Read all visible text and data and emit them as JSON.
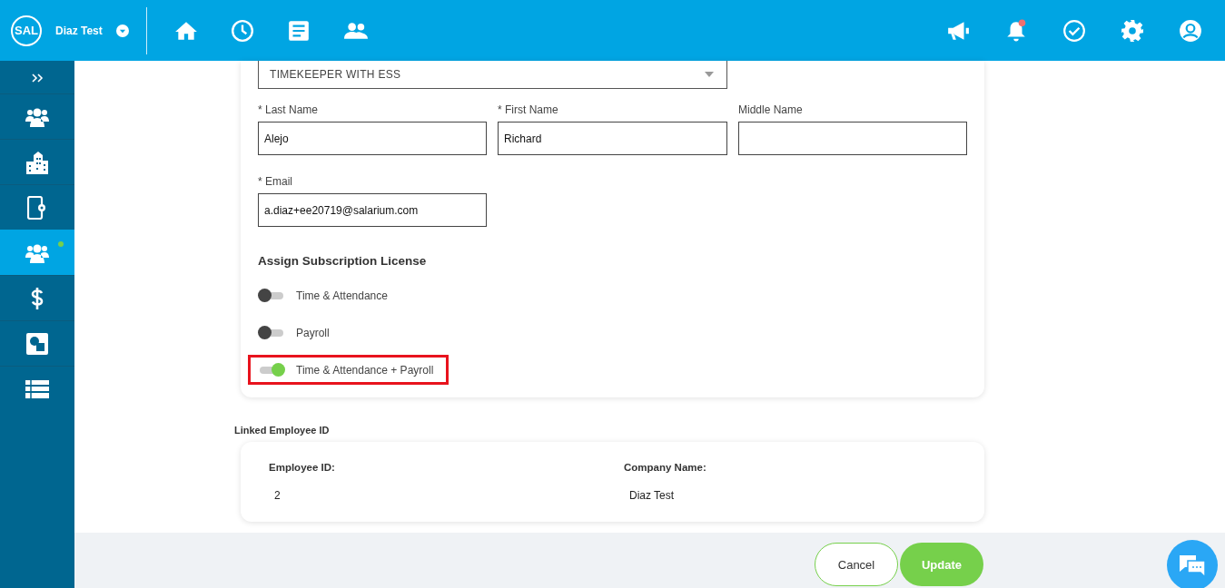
{
  "header": {
    "logo": "SAL",
    "company": "Diaz Test",
    "unread_notifications": true
  },
  "sidebar": {
    "items": [
      {
        "kind": "people",
        "selected": false,
        "badge": false
      },
      {
        "kind": "building",
        "selected": false,
        "badge": false
      },
      {
        "kind": "device",
        "selected": false,
        "badge": false
      },
      {
        "kind": "people",
        "selected": true,
        "badge": true
      },
      {
        "kind": "dollar",
        "selected": false,
        "badge": false
      },
      {
        "kind": "shapes",
        "selected": false,
        "badge": false
      },
      {
        "kind": "list",
        "selected": false,
        "badge": false
      }
    ]
  },
  "form": {
    "role": "TIMEKEEPER WITH ESS",
    "fields": [
      {
        "label": "* Last Name",
        "value": "Alejo"
      },
      {
        "label": "* First Name",
        "value": "Richard"
      },
      {
        "label": "Middle Name"
      },
      {
        "label": "* Email",
        "value": "a.diaz+ee20719@salarium.com"
      }
    ],
    "license_heading": "Assign Subscription License",
    "licenses": [
      {
        "label": "Time & Attendance",
        "on": false,
        "highlighted": false
      },
      {
        "label": "Payroll",
        "on": false,
        "highlighted": false
      },
      {
        "label": "Time & Attendance + Payroll",
        "on": true,
        "highlighted": true
      }
    ]
  },
  "linked": {
    "title": "Linked Employee ID",
    "columns": [
      {
        "heading": "Employee ID:",
        "value": "2"
      },
      {
        "heading": "Company Name:",
        "value": "Diaz Test"
      }
    ]
  },
  "buttons": [
    {
      "label": "Cancel",
      "kind": "secondary"
    },
    {
      "label": "Update",
      "kind": "primary"
    }
  ]
}
